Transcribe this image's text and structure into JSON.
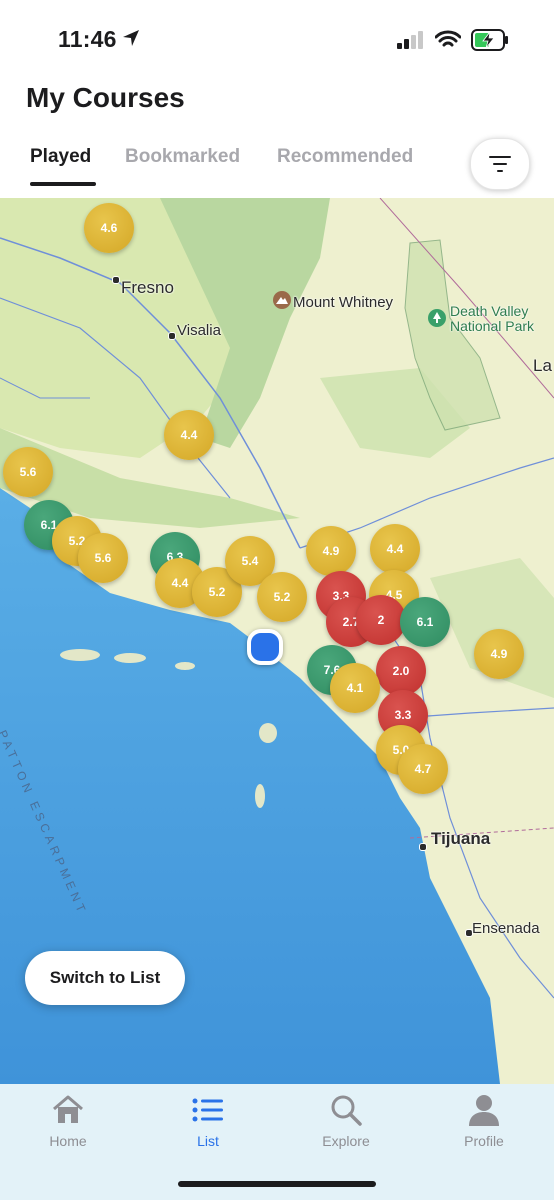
{
  "status_bar": {
    "time": "11:46"
  },
  "header": {
    "title": "My Courses"
  },
  "tabs": [
    {
      "label": "Played",
      "active": true
    },
    {
      "label": "Bookmarked",
      "active": false
    },
    {
      "label": "Recommended",
      "active": false
    }
  ],
  "map": {
    "places": {
      "fresno": "Fresno",
      "visalia": "Visalia",
      "mount_whitney": "Mount Whitney",
      "death_valley": "Death Valley",
      "death_valley_2": "National Park",
      "la_partial": "La",
      "tijuana": "Tijuana",
      "ensenada": "Ensenada",
      "patton": "PATTON ESCARPMENT"
    },
    "pins": [
      {
        "rating": "4.6",
        "color": "yellow"
      },
      {
        "rating": "4.4",
        "color": "yellow"
      },
      {
        "rating": "5.6",
        "color": "yellow"
      },
      {
        "rating": "6.1",
        "color": "green"
      },
      {
        "rating": "5.2",
        "color": "yellow"
      },
      {
        "rating": "5.6",
        "color": "yellow"
      },
      {
        "rating": "6.3",
        "color": "green"
      },
      {
        "rating": "4.4",
        "color": "yellow"
      },
      {
        "rating": "5.2",
        "color": "yellow"
      },
      {
        "rating": "5.4",
        "color": "yellow"
      },
      {
        "rating": "4.9",
        "color": "yellow"
      },
      {
        "rating": "4.4",
        "color": "yellow"
      },
      {
        "rating": "5.2",
        "color": "yellow"
      },
      {
        "rating": "3.3",
        "color": "red"
      },
      {
        "rating": "4.5",
        "color": "yellow"
      },
      {
        "rating": "2.7",
        "color": "red"
      },
      {
        "rating": "2",
        "color": "red"
      },
      {
        "rating": "6.1",
        "color": "green"
      },
      {
        "rating": "4.9",
        "color": "yellow"
      },
      {
        "rating": "7.6",
        "color": "green"
      },
      {
        "rating": "2.0",
        "color": "red"
      },
      {
        "rating": "4.1",
        "color": "yellow"
      },
      {
        "rating": "3.3",
        "color": "red"
      },
      {
        "rating": "5.0",
        "color": "yellow"
      },
      {
        "rating": "4.7",
        "color": "yellow"
      }
    ],
    "switch_label": "Switch to List"
  },
  "nav": [
    {
      "label": "Home",
      "icon": "home-icon",
      "active": false
    },
    {
      "label": "List",
      "icon": "list-icon",
      "active": true
    },
    {
      "label": "Explore",
      "icon": "search-icon",
      "active": false
    },
    {
      "label": "Profile",
      "icon": "profile-icon",
      "active": false
    }
  ],
  "colors": {
    "accent": "#2a72e8",
    "pin_yellow": "#d9b032",
    "pin_red": "#c9403c",
    "pin_green": "#3a9a6e",
    "water": "#4d9fe0"
  }
}
